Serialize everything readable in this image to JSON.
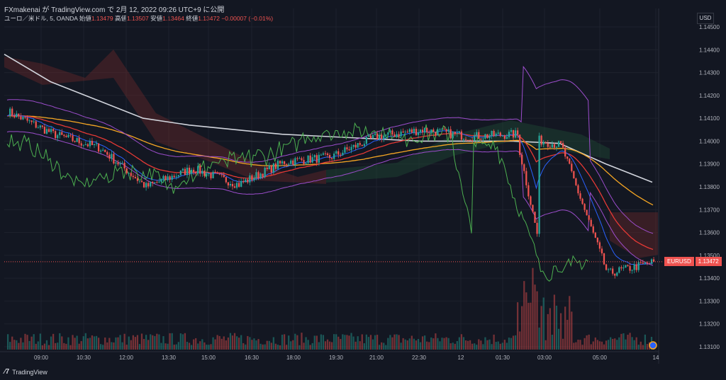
{
  "header": {
    "title": "FXmakenai が TradingView.com で 2月 12, 2022 09:26 UTC+9 に公開",
    "symbol_info": "ユーロ／米ドル, 5, OANDA",
    "open_label": "始値",
    "open_value": "1.13479",
    "high_label": "高値",
    "high_value": "1.13507",
    "low_label": "安値",
    "low_value": "1.13464",
    "close_label": "終値",
    "close_value": "1.13472",
    "change": "−0.00007 (−0.01%)"
  },
  "price_scale": {
    "currency": "USD",
    "labels": [
      "1.14500",
      "1.14400",
      "1.14300",
      "1.14200",
      "1.14100",
      "1.14000",
      "1.13900",
      "1.13800",
      "1.13700",
      "1.13600",
      "1.13500",
      "1.13400",
      "1.13300",
      "1.13200",
      "1.13100"
    ]
  },
  "last_price": {
    "symbol": "EURUSD",
    "value": "1.13472"
  },
  "time_axis": {
    "labels": [
      "09:00",
      "10:30",
      "12:00",
      "13:30",
      "15:00",
      "16:30",
      "18:00",
      "19:30",
      "21:00",
      "22:30",
      "12",
      "01:30",
      "03:00",
      "05:00",
      "14"
    ]
  },
  "footer": {
    "brand": "TradingView"
  },
  "colors": {
    "background": "#131722",
    "up": "#26a69a",
    "down": "#ef5350",
    "sma_white": "#d1d4dc",
    "ema_orange": "#f5a623",
    "ema_red": "#e53935",
    "ema_blue": "#2962ff",
    "bollinger": "#9c4dcc",
    "chikou": "#4caf50",
    "cloud_red": "#7f2a2a",
    "cloud_green": "#1e4a35"
  },
  "chart_data": {
    "type": "line",
    "instrument": "EURUSD",
    "timeframe": "5",
    "ylim": [
      1.1308,
      1.1455
    ],
    "x": [
      "09:00",
      "10:30",
      "12:00",
      "13:30",
      "15:00",
      "16:30",
      "18:00",
      "19:30",
      "21:00",
      "22:30",
      "12",
      "01:30",
      "03:00",
      "05:00",
      "14"
    ],
    "series": [
      {
        "values": [
          1.1413,
          1.1403,
          1.1397,
          1.138,
          1.1388,
          1.1381,
          1.1391,
          1.1393,
          1.1402,
          1.1405,
          1.1402,
          1.1403,
          1.1398,
          1.1342,
          1.1347
        ]
      },
      {
        "values": [
          1.1438,
          1.1426,
          1.1418,
          1.141,
          1.1407,
          1.1405,
          1.1403,
          1.1402,
          1.1401,
          1.14,
          1.14,
          1.14,
          1.1399,
          1.139,
          1.1382
        ]
      }
    ]
  }
}
